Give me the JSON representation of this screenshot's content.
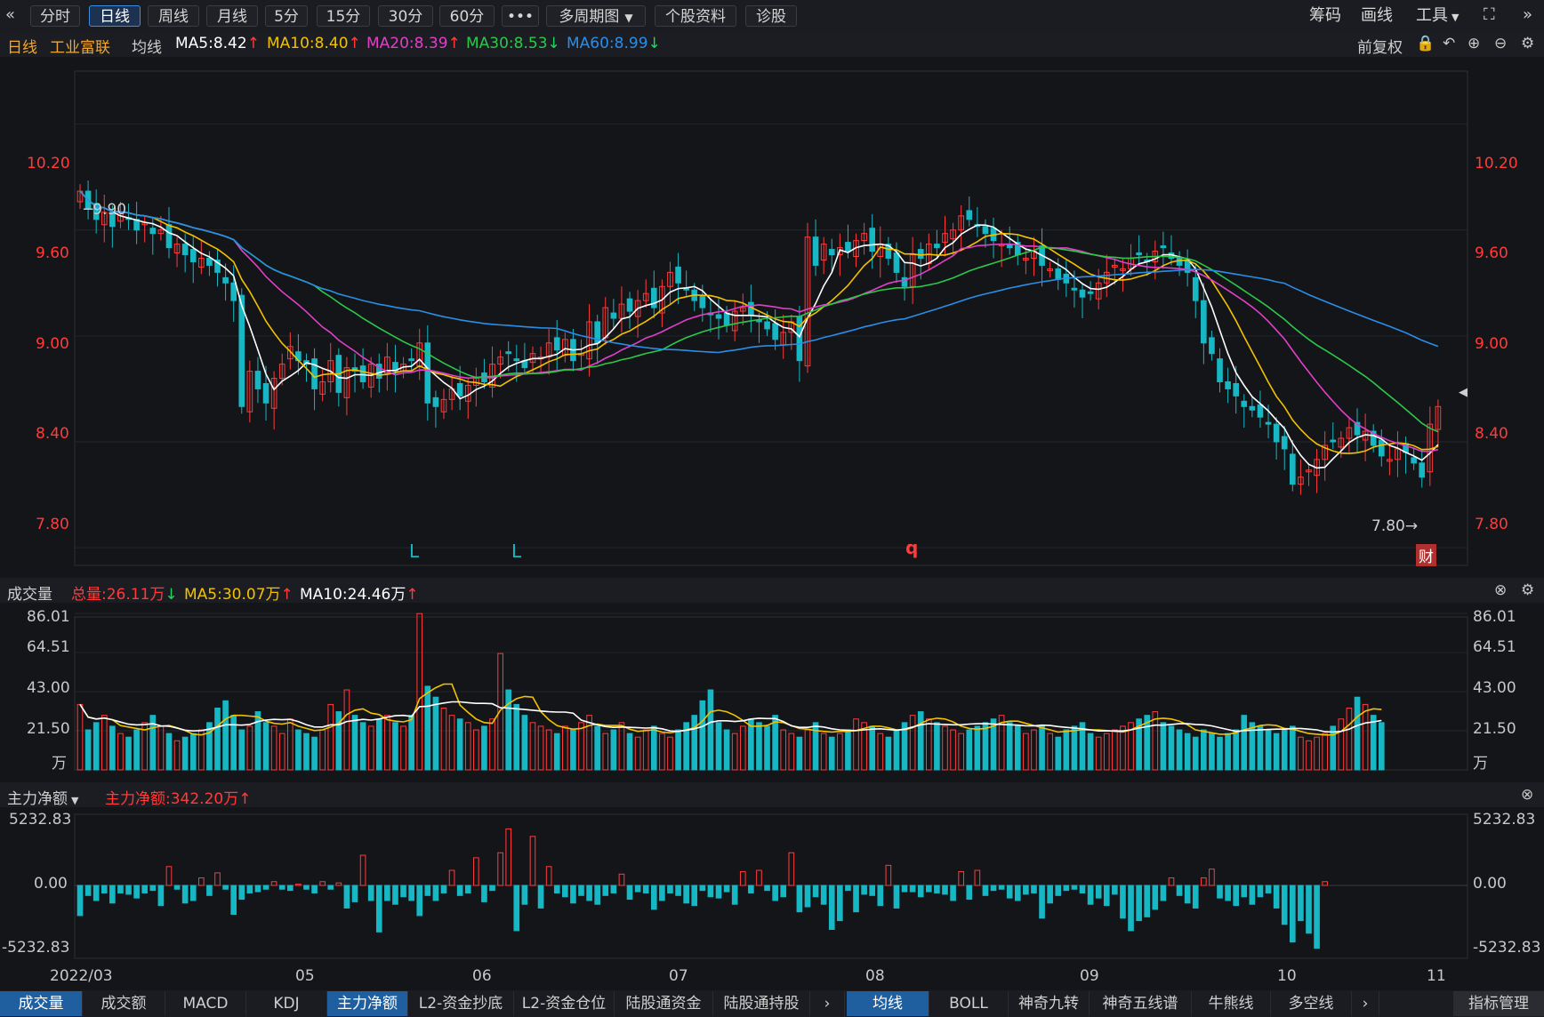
{
  "toolbar": {
    "periods": [
      "分时",
      "日线",
      "周线",
      "月线",
      "5分",
      "15分",
      "30分",
      "60分"
    ],
    "active_period": "日线",
    "more": "•••",
    "multi_period": "多周期图",
    "stock_info": "个股资料",
    "diagnose": "诊股",
    "chips": "筹码",
    "draw": "画线",
    "tools": "工具",
    "back_icon": "«",
    "expand_icon": "»"
  },
  "main_header": {
    "period": "日线",
    "stock_name": "工业富联",
    "ma_label": "均线",
    "ma5": "MA5:8.42",
    "ma10": "MA10:8.40",
    "ma20": "MA20:8.39",
    "ma30": "MA30:8.53",
    "ma60": "MA60:8.99",
    "adjust": "前复权"
  },
  "price_axis": [
    "10.20",
    "9.60",
    "9.00",
    "8.40",
    "7.80"
  ],
  "price_marks": {
    "high": "9.90",
    "low": "7.80"
  },
  "signal_marks": [
    "L",
    "L",
    "q"
  ],
  "finance_badge": "财",
  "volume_header": {
    "title": "成交量",
    "total": "总量:26.11万",
    "ma5": "MA5:30.07万",
    "ma10": "MA10:24.46万"
  },
  "volume_axis": [
    "86.01",
    "64.51",
    "43.00",
    "21.50",
    "万"
  ],
  "capital_header": {
    "title": "主力净额",
    "net": "主力净额:342.20万"
  },
  "capital_axis": [
    "5232.83",
    "0.00",
    "-5232.83"
  ],
  "date_axis": [
    "2022/03",
    "05",
    "06",
    "07",
    "08",
    "09",
    "10",
    "11"
  ],
  "bottom_tabs_left": [
    "成交量",
    "成交额",
    "MACD",
    "KDJ",
    "主力净额",
    "L2-资金抄底",
    "L2-资金仓位",
    "陆股通资金",
    "陆股通持股"
  ],
  "bottom_tabs_right": [
    "均线",
    "BOLL",
    "神奇九转",
    "神奇五线谱",
    "牛熊线",
    "多空线"
  ],
  "indicator_manage": "指标管理",
  "colors": {
    "up": "#ff3b3b",
    "down": "#17b7c4",
    "ma5": "#ffffff",
    "ma10": "#f2c200",
    "ma20": "#e040c8",
    "ma30": "#2cc84a",
    "ma60": "#2a8ee8",
    "active": "#1f5fa0"
  },
  "chart_data": {
    "type": "candlestick",
    "price_ylim": [
      7.7,
      10.5
    ],
    "volume_ylim": [
      0,
      90
    ],
    "capital_ylim": [
      -5232.83,
      5232.83
    ],
    "closes": [
      9.82,
      9.72,
      9.66,
      9.7,
      9.62,
      9.7,
      9.66,
      9.6,
      9.64,
      9.58,
      9.6,
      9.5,
      9.52,
      9.46,
      9.42,
      9.44,
      9.4,
      9.36,
      9.3,
      9.2,
      8.6,
      8.8,
      8.7,
      8.62,
      8.76,
      8.84,
      8.94,
      8.86,
      8.84,
      8.7,
      8.74,
      8.86,
      8.68,
      8.82,
      8.8,
      8.74,
      8.84,
      8.76,
      8.88,
      8.8,
      8.84,
      8.86,
      8.96,
      8.62,
      8.6,
      8.64,
      8.7,
      8.66,
      8.72,
      8.76,
      8.74,
      8.84,
      8.88,
      8.9,
      8.86,
      8.82,
      8.9,
      8.88,
      8.96,
      8.92,
      8.98,
      8.86,
      8.9,
      9.08,
      8.96,
      9.16,
      9.1,
      9.18,
      9.14,
      9.2,
      9.24,
      9.16,
      9.28,
      9.36,
      9.3,
      9.26,
      9.2,
      9.16,
      9.12,
      9.1,
      9.06,
      9.14,
      9.16,
      9.12,
      9.08,
      9.04,
      8.98,
      9.02,
      9.08,
      8.86,
      9.56,
      9.4,
      9.52,
      9.46,
      9.5,
      9.48,
      9.54,
      9.58,
      9.48,
      9.52,
      9.44,
      9.36,
      9.28,
      9.46,
      9.44,
      9.52,
      9.5,
      9.58,
      9.6,
      9.68,
      9.66,
      9.62,
      9.58,
      9.54,
      9.52,
      9.5,
      9.46,
      9.44,
      9.48,
      9.4,
      9.38,
      9.32,
      9.3,
      9.26,
      9.22,
      9.24,
      9.3,
      9.36,
      9.4,
      9.38,
      9.44,
      9.46,
      9.42,
      9.48,
      9.5,
      9.44,
      9.4,
      9.36,
      9.2,
      8.96,
      8.9,
      8.74,
      8.7,
      8.66,
      8.6,
      8.58,
      8.54,
      8.5,
      8.4,
      8.36,
      8.16,
      8.2,
      8.24,
      8.3,
      8.38,
      8.4,
      8.42,
      8.48,
      8.44,
      8.46,
      8.38,
      8.32,
      8.3,
      8.36,
      8.34,
      8.28,
      8.2,
      8.5,
      8.6
    ],
    "volumes": [
      36,
      22,
      26,
      30,
      24,
      20,
      18,
      22,
      26,
      30,
      24,
      20,
      16,
      18,
      20,
      22,
      26,
      34,
      38,
      30,
      22,
      24,
      32,
      26,
      24,
      20,
      28,
      22,
      20,
      18,
      22,
      36,
      32,
      44,
      30,
      26,
      24,
      28,
      30,
      26,
      24,
      30,
      86,
      46,
      40,
      34,
      30,
      28,
      26,
      22,
      24,
      28,
      64,
      44,
      36,
      30,
      26,
      24,
      22,
      20,
      24,
      22,
      26,
      30,
      24,
      20,
      22,
      26,
      20,
      18,
      22,
      24,
      20,
      18,
      22,
      26,
      30,
      38,
      44,
      26,
      22,
      20,
      24,
      28,
      26,
      24,
      30,
      22,
      20,
      18,
      22,
      26,
      20,
      18,
      20,
      22,
      28,
      26,
      24,
      20,
      18,
      22,
      26,
      30,
      32,
      28,
      26,
      24,
      22,
      20,
      22,
      24,
      26,
      28,
      30,
      26,
      24,
      20,
      22,
      24,
      20,
      18,
      22,
      24,
      26,
      20,
      18,
      20,
      22,
      24,
      26,
      28,
      30,
      32,
      26,
      24,
      22,
      20,
      18,
      22,
      20,
      18,
      20,
      22,
      30,
      26,
      24,
      22,
      20,
      22,
      24,
      18,
      16,
      18,
      20,
      24,
      28,
      34,
      40,
      36,
      30,
      26
    ],
    "capital_net": [
      -2400,
      -800,
      -1200,
      -600,
      -1400,
      -600,
      -700,
      -1000,
      -600,
      -400,
      -1600,
      1500,
      -300,
      -1400,
      -1200,
      600,
      -800,
      1000,
      -300,
      -2300,
      -1100,
      -600,
      -500,
      -300,
      300,
      -300,
      -400,
      100,
      -300,
      -600,
      300,
      -300,
      200,
      -1800,
      -1300,
      2400,
      -1200,
      -3700,
      -1200,
      -1500,
      -900,
      -1200,
      -2400,
      -800,
      -1200,
      -600,
      1200,
      -800,
      -600,
      2200,
      -1300,
      -400,
      2600,
      4500,
      -3600,
      -1500,
      3900,
      -1800,
      1500,
      -600,
      -900,
      -1400,
      -800,
      -1200,
      -1500,
      -800,
      -600,
      900,
      -1100,
      -500,
      -600,
      -1900,
      -1200,
      -600,
      -800,
      -1400,
      -1600,
      -400,
      -900,
      -1000,
      -500,
      -1500,
      1100,
      -600,
      1200,
      -400,
      -1200,
      -900,
      2600,
      -2100,
      -1700,
      -900,
      -1500,
      -3500,
      -2800,
      -400,
      -2100,
      -700,
      -800,
      -1600,
      1600,
      -1800,
      -500,
      -500,
      -900,
      -500,
      -600,
      -700,
      -1200,
      1100,
      -1100,
      1200,
      -800,
      -400,
      -300,
      -1000,
      -1200,
      -700,
      -600,
      -2600,
      -1400,
      -800,
      -400,
      -300,
      -600,
      -1500,
      -1000,
      -1600,
      -700,
      -2600,
      -3600,
      -2800,
      -2500,
      -1900,
      -1200,
      600,
      -800,
      -1400,
      -1800,
      600,
      1300,
      -1000,
      -1200,
      -1600,
      -900,
      -1500,
      -900,
      -600,
      -1800,
      -3100,
      -4500,
      -2800,
      -3800,
      -5000,
      300
    ]
  }
}
